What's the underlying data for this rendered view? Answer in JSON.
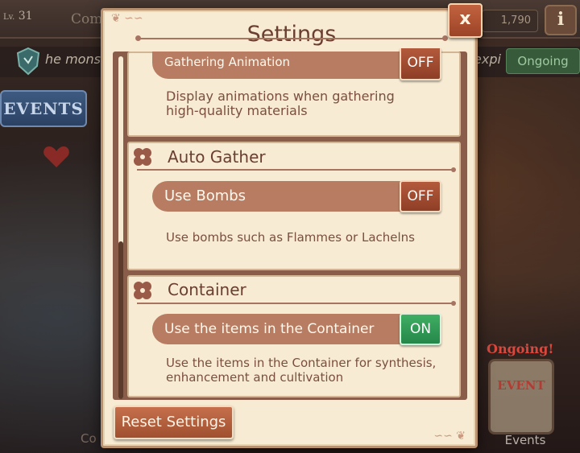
{
  "background": {
    "level_prefix": "Lv.",
    "level": "31",
    "top_partial_text": "Com",
    "coins": "1,790",
    "info_icon": "i",
    "quest_partial_text": "he mons",
    "quest_partial_exp": "expi",
    "ongoing_top": "Ongoing",
    "events_banner": "EVENTS",
    "bottom_partial_text": "Co",
    "ongoing_red": "Ongoing!",
    "event_card": "EVENT",
    "events_label": "Events"
  },
  "dialog": {
    "title": "Settings",
    "close_label": "x",
    "reset_label": "Reset Settings"
  },
  "sections": {
    "gathering": {
      "row_label": "Gathering Animation",
      "toggle": "OFF",
      "description_line1": "Display animations when gathering",
      "description_line2": "high-quality materials"
    },
    "auto_gather": {
      "title": "Auto Gather",
      "row_label": "Use Bombs",
      "toggle": "OFF",
      "description": "Use bombs such as Flammes or Lachelns"
    },
    "container": {
      "title": "Container",
      "row_label": "Use the items in the Container",
      "toggle": "ON",
      "description_line1": "Use the items in the Container for synthesis,",
      "description_line2": "enhancement and cultivation"
    }
  },
  "colors": {
    "dialog_bg": "#f7ebd3",
    "row_bar": "#b77c61",
    "toggle_off": "#a44a2f",
    "toggle_on": "#33a059",
    "title_text": "#6a3e30"
  }
}
